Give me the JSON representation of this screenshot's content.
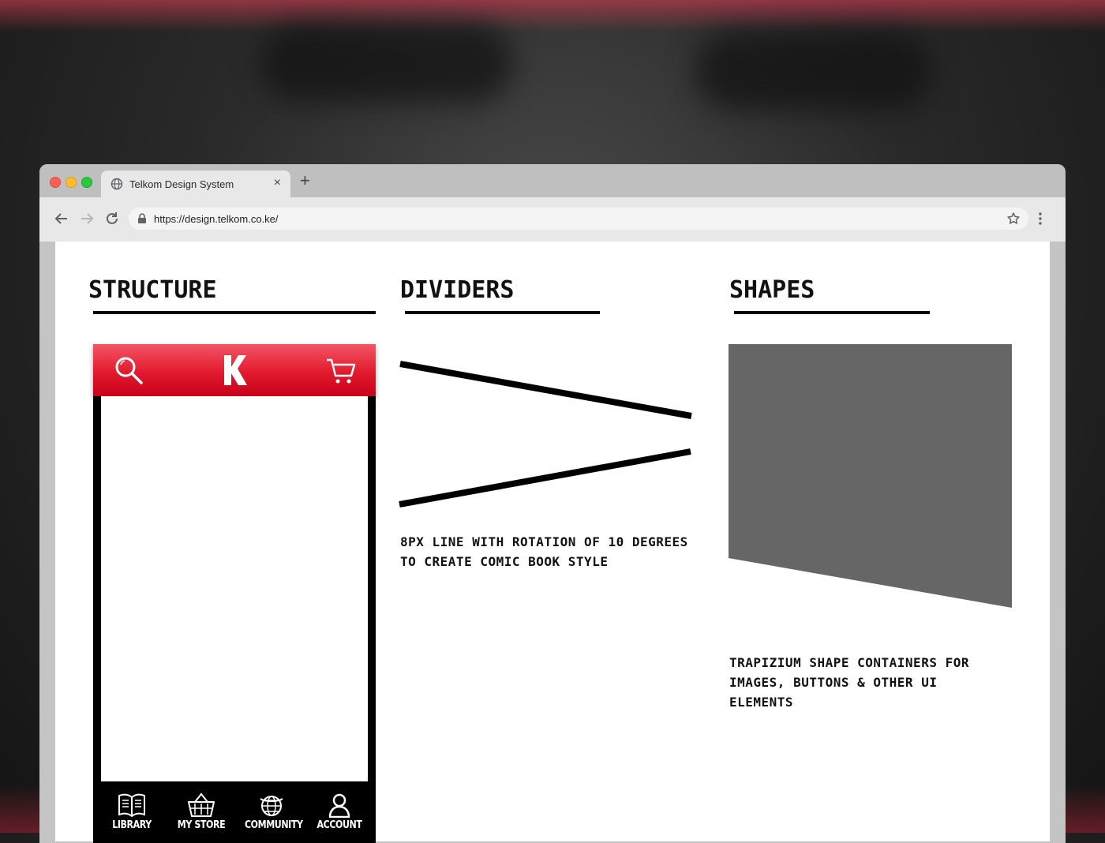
{
  "browser": {
    "tab_title": "Telkom Design System",
    "url": "https://design.telkom.co.ke/"
  },
  "sections": {
    "structure": {
      "heading": "STRUCTURE"
    },
    "dividers": {
      "heading": "DIVIDERS",
      "caption_line1": "8PX LINE WITH ROTATION OF 10 DEGREES",
      "caption_line2": "TO CREATE COMIC BOOK STYLE"
    },
    "shapes": {
      "heading": "SHAPES",
      "caption_line1": "TRAPIZIUM SHAPE CONTAINERS FOR",
      "caption_line2": "IMAGES, BUTTONS & OTHER UI",
      "caption_line3": "ELEMENTS"
    }
  },
  "phone": {
    "logo_letter": "K",
    "nav": [
      {
        "label": "LIBRARY",
        "icon": "book-icon"
      },
      {
        "label": "MY STORE",
        "icon": "basket-icon"
      },
      {
        "label": "COMMUNITY",
        "icon": "globe-icon"
      },
      {
        "label": "ACCOUNT",
        "icon": "user-icon"
      }
    ]
  },
  "colors": {
    "brand_red": "#e21a2d",
    "shape_gray": "#666666"
  }
}
